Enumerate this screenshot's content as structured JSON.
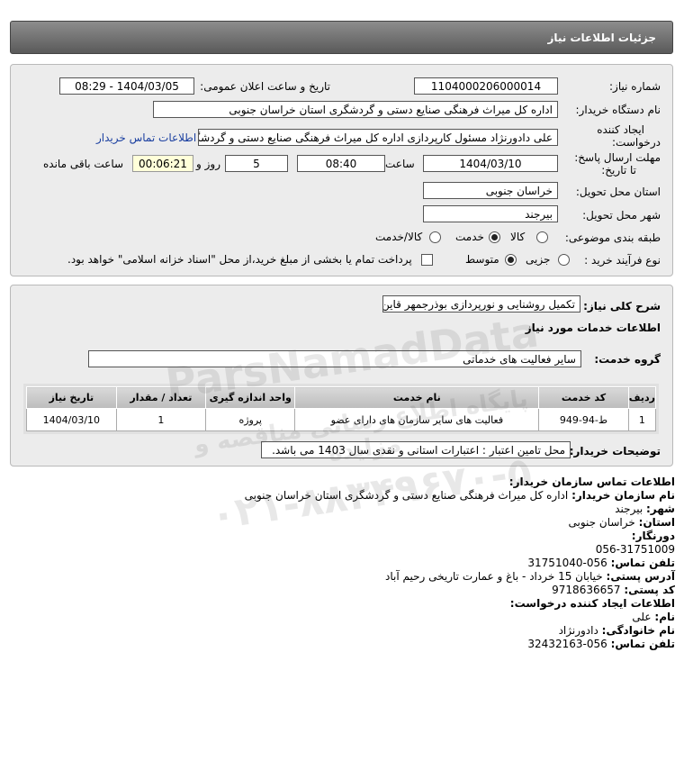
{
  "header": {
    "title": "جزئیات اطلاعات نیاز"
  },
  "form": {
    "need_no_label": "شماره نیاز:",
    "need_no": "1104000206000014",
    "announce_label": "تاریخ و ساعت اعلان عمومی:",
    "announce_value": "1404/03/05 - 08:29",
    "buyer_label": "نام دستگاه خریدار:",
    "buyer_value": "اداره کل میراث فرهنگی  صنایع دستی و گردشگری استان خراسان جنوبی",
    "creator_label1": "ایجاد کننده",
    "creator_label2": "درخواست:",
    "creator_value": "علی دادورنژاد مسئول کارپردازی اداره کل میراث فرهنگی  صنایع دستی و گردشگری",
    "contact_link": "اطلاعات تماس خریدار",
    "deadline_label1": "مهلت ارسال پاسخ:",
    "deadline_label2": "تا تاریخ:",
    "deadline_date": "1404/03/10",
    "time_label": "ساعت",
    "deadline_time": "08:40",
    "days_value": "5",
    "days_label": "روز و",
    "remaining_time": "00:06:21",
    "remaining_label": "ساعت باقی مانده",
    "province_label": "استان محل تحویل:",
    "province_value": "خراسان جنوبی",
    "city_label": "شهر محل تحویل:",
    "city_value": "بیرجند",
    "category_label": "طبقه بندی موضوعی:",
    "category_options": [
      "کالا",
      "خدمت",
      "کالا/خدمت"
    ],
    "process_label": "نوع فرآیند خرید :",
    "process_options": [
      "جزیی",
      "متوسط"
    ],
    "payment_note": "پرداخت تمام یا بخشی از مبلغ خرید،از محل \"اسناد خزانه اسلامی\" خواهد بود."
  },
  "summary": {
    "desc_label": "شرح کلی نیاز:",
    "desc_value": "تکمیل روشنایی و نورپردازی بوذرجمهر قاین",
    "services_title": "اطلاعات خدمات مورد نیاز",
    "group_label": "گروه خدمت:",
    "group_value": "سایر فعالیت های خدماتی",
    "table": {
      "headers": [
        "ردیف",
        "کد خدمت",
        "نام خدمت",
        "واحد اندازه گیری",
        "تعداد / مقدار",
        "تاریخ نیاز"
      ],
      "rows": [
        [
          "1",
          "ط-94-949",
          "فعالیت های سایر سازمان های دارای عضو",
          "پروژه",
          "1",
          "1404/03/10"
        ]
      ]
    },
    "buyer_notes_label": "توضیحات خریدار:",
    "buyer_notes_value": "محل تامین اعتبار : اعتبارات استانی و نقدی سال 1403 می باشد."
  },
  "contact": {
    "org_title": "اطلاعات تماس سازمان خریدار:",
    "org_name_label": "نام سازمان خریدار:",
    "org_name": "اداره کل میراث فرهنگی صنایع دستی و گردشگری استان خراسان جنوبی",
    "city_label": "شهر:",
    "city": "بیرجند",
    "province_label": "استان:",
    "province": "خراسان جنوبی",
    "fax_label": "دورنگار:",
    "fax": "056-31751009",
    "phone_label": "تلفن تماس:",
    "phone": "056-31751040",
    "address_label": "آدرس پستی:",
    "address": "خیابان 15 خرداد - باغ و عمارت تاریخی رحیم آباد",
    "postal_label": "کد پستی:",
    "postal": "9718636657",
    "creator_title": "اطلاعات ایجاد کننده درخواست:",
    "first_name_label": "نام:",
    "first_name": "علی",
    "last_name_label": "نام خانوادگی:",
    "last_name": "دادورنژاد",
    "creator_phone_label": "تلفن تماس:",
    "creator_phone": "056-32432163"
  },
  "watermark": {
    "line1": "پایگاه اطلاع رسانی مناقصه و مزایده",
    "line2": "ParsNamadData",
    "line3": "۰۲۱-۸۸۳۴۹۶۷۰-۵"
  }
}
